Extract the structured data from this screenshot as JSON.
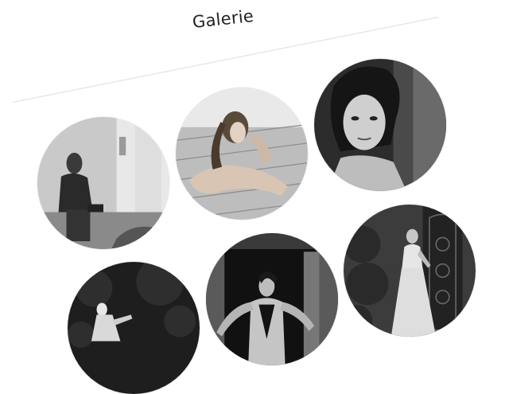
{
  "gallery": {
    "title": "Galerie",
    "photos": [
      {
        "alt": "photo-man-sitting"
      },
      {
        "alt": "photo-woman-lying-deck"
      },
      {
        "alt": "photo-woman-portrait-closeup"
      },
      {
        "alt": "photo-woman-dark-forest"
      },
      {
        "alt": "photo-woman-doorway"
      },
      {
        "alt": "photo-woman-gown-garden"
      }
    ]
  }
}
